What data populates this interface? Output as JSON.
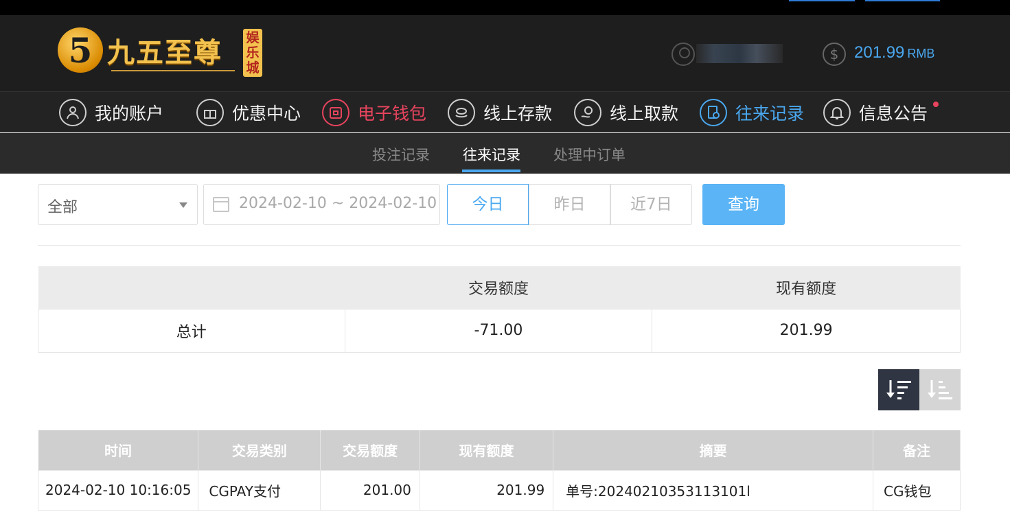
{
  "brand": {
    "logo_mark": "5",
    "name": "九五至尊",
    "badge": "娱乐城"
  },
  "header": {
    "balance_amount": "201.99",
    "balance_unit": "RMB"
  },
  "nav": [
    {
      "label": "我的账户",
      "icon": "user-icon"
    },
    {
      "label": "优惠中心",
      "icon": "gift-icon"
    },
    {
      "label": "电子钱包",
      "icon": "wallet-icon"
    },
    {
      "label": "线上存款",
      "icon": "deposit-icon"
    },
    {
      "label": "线上取款",
      "icon": "withdraw-icon"
    },
    {
      "label": "往来记录",
      "icon": "record-icon"
    },
    {
      "label": "信息公告",
      "icon": "bell-icon"
    }
  ],
  "subnav": {
    "tabs": [
      "投注记录",
      "往来记录",
      "处理中订单"
    ],
    "active": "往来记录"
  },
  "filters": {
    "type_selected": "全部",
    "date_range": "2024-02-10 ~ 2024-02-10",
    "quick": [
      "今日",
      "昨日",
      "近7日"
    ],
    "query_label": "查询"
  },
  "summary": {
    "headers": [
      "",
      "交易额度",
      "现有额度"
    ],
    "row": [
      "总计",
      "-71.00",
      "201.99"
    ]
  },
  "records": {
    "headers": [
      "时间",
      "交易类别",
      "交易额度",
      "现有额度",
      "摘要",
      "备注"
    ],
    "rows": [
      [
        "2024-02-10 10:16:05",
        "CGPAY支付",
        "201.00",
        "201.99",
        "单号:20240210353113101l",
        "CG钱包"
      ]
    ]
  },
  "colors": {
    "accent_blue": "#4aa8f0",
    "accent_red": "#e8445e",
    "gold": "#f2c14e"
  }
}
